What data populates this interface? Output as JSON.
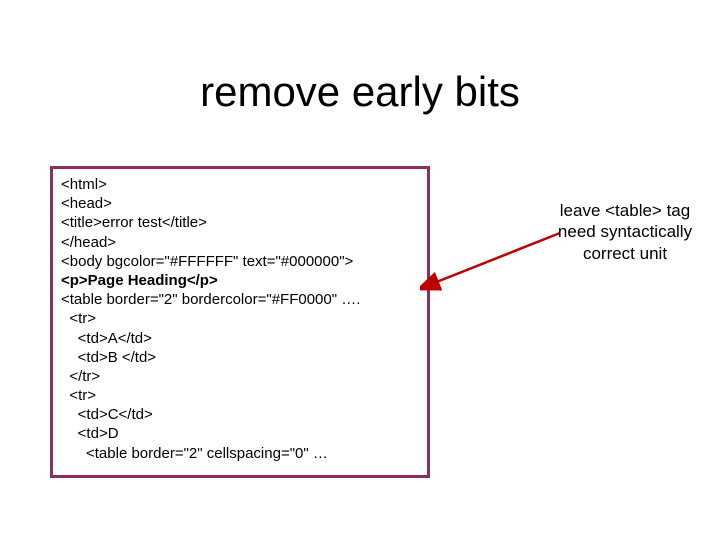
{
  "title": "remove early bits",
  "code": {
    "l1": "<html>",
    "l2": "<head>",
    "l3": "<title>error test</title>",
    "l4": "</head>",
    "l5": "<body bgcolor=\"#FFFFFF\" text=\"#000000\">",
    "l6": "<p>Page Heading</p>",
    "l7": "<table border=\"2\" bordercolor=\"#FF0000\" ….",
    "l8": "  <tr>",
    "l9": "    <td>A</td>",
    "l10": "    <td>B </td>",
    "l11": "  </tr>",
    "l12": "  <tr>",
    "l13": "    <td>C</td>",
    "l14": "    <td>D",
    "l15": "      <table border=\"2\" cellspacing=\"0\" …"
  },
  "annotation": {
    "line1": "leave <table> tag",
    "line2": "need syntactically",
    "line3": "correct unit"
  },
  "colors": {
    "box_border": "#8b2f5e",
    "arrow": "#c00000"
  }
}
